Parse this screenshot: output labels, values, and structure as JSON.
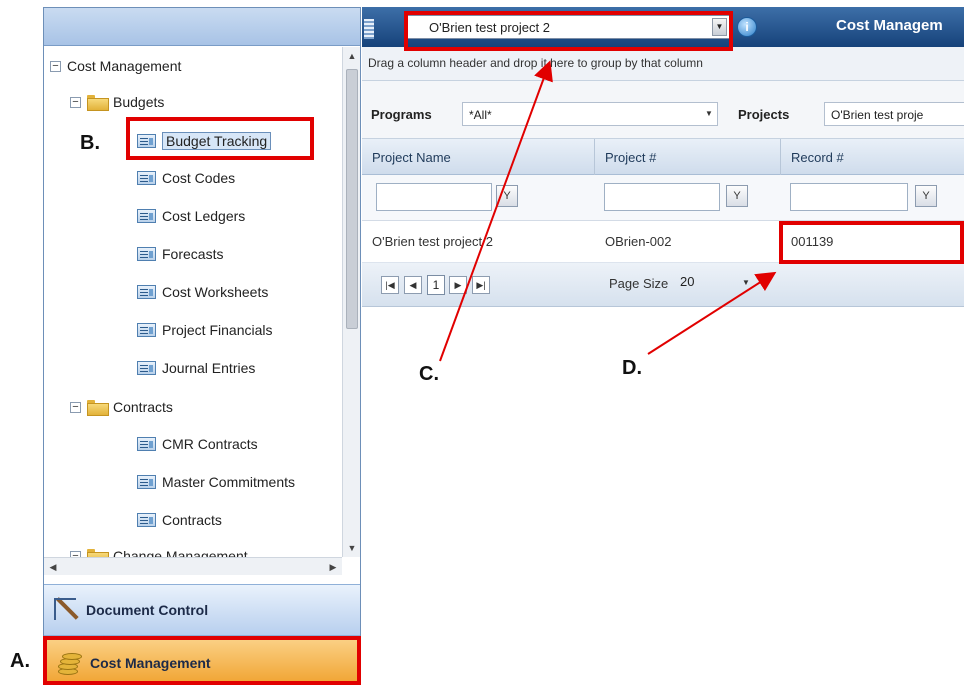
{
  "left_panel": {
    "tree": {
      "root": "Cost Management",
      "budgets_folder": "Budgets",
      "budget_items": [
        "Budget Tracking",
        "Cost Codes",
        "Cost Ledgers",
        "Forecasts",
        "Cost Worksheets",
        "Project Financials",
        "Journal Entries"
      ],
      "contracts_folder": "Contracts",
      "contract_items": [
        "CMR Contracts",
        "Master Commitments",
        "Contracts"
      ],
      "partial_folder": "Change Management",
      "selected": "Budget Tracking"
    },
    "nav_buttons": {
      "document_control": "Document Control",
      "cost_management": "Cost Management"
    }
  },
  "toolbar": {
    "project_selected": "O'Brien test project 2",
    "module_title": "Cost Managem"
  },
  "grid": {
    "group_hint": "Drag a column header and drop it here to group by that column",
    "filters": {
      "programs_label": "Programs",
      "programs_value": "*All*",
      "projects_label": "Projects",
      "projects_value": "O'Brien test proje"
    },
    "columns": [
      "Project Name",
      "Project #",
      "Record #"
    ],
    "rows": [
      {
        "project_name": "O'Brien test project 2",
        "project_number": "OBrien-002",
        "record_number": "001139"
      }
    ],
    "pager": {
      "current_page": "1",
      "page_size_label": "Page Size",
      "page_size": "20"
    }
  },
  "annotations": {
    "a": "A.",
    "b": "B.",
    "c": "C.",
    "d": "D."
  },
  "colors": {
    "highlight": "#e10000",
    "header_blue": "#16427a",
    "cost_button": "#f0a02a"
  }
}
